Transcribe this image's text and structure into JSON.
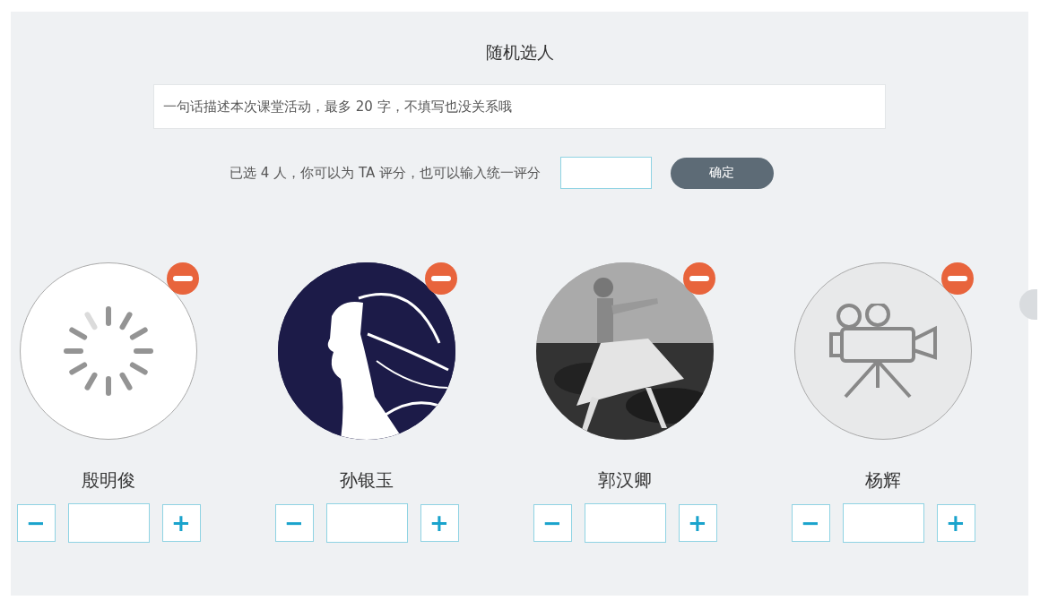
{
  "title": "随机选人",
  "description": {
    "placeholder": "一句话描述本次课堂活动，最多 20 字，不填写也没关系哦"
  },
  "score_bar": {
    "label": "已选 4 人，你可以为 TA 评分，也可以输入统一评分",
    "confirm": "确定"
  },
  "students": [
    {
      "name": "殷明俊",
      "kind": "loading",
      "minus": "−",
      "plus": "+"
    },
    {
      "name": "孙银玉",
      "kind": "illustration",
      "minus": "−",
      "plus": "+"
    },
    {
      "name": "郭汉卿",
      "kind": "picture",
      "minus": "−",
      "plus": "+"
    },
    {
      "name": "杨辉",
      "kind": "camera",
      "minus": "−",
      "plus": "+"
    }
  ]
}
